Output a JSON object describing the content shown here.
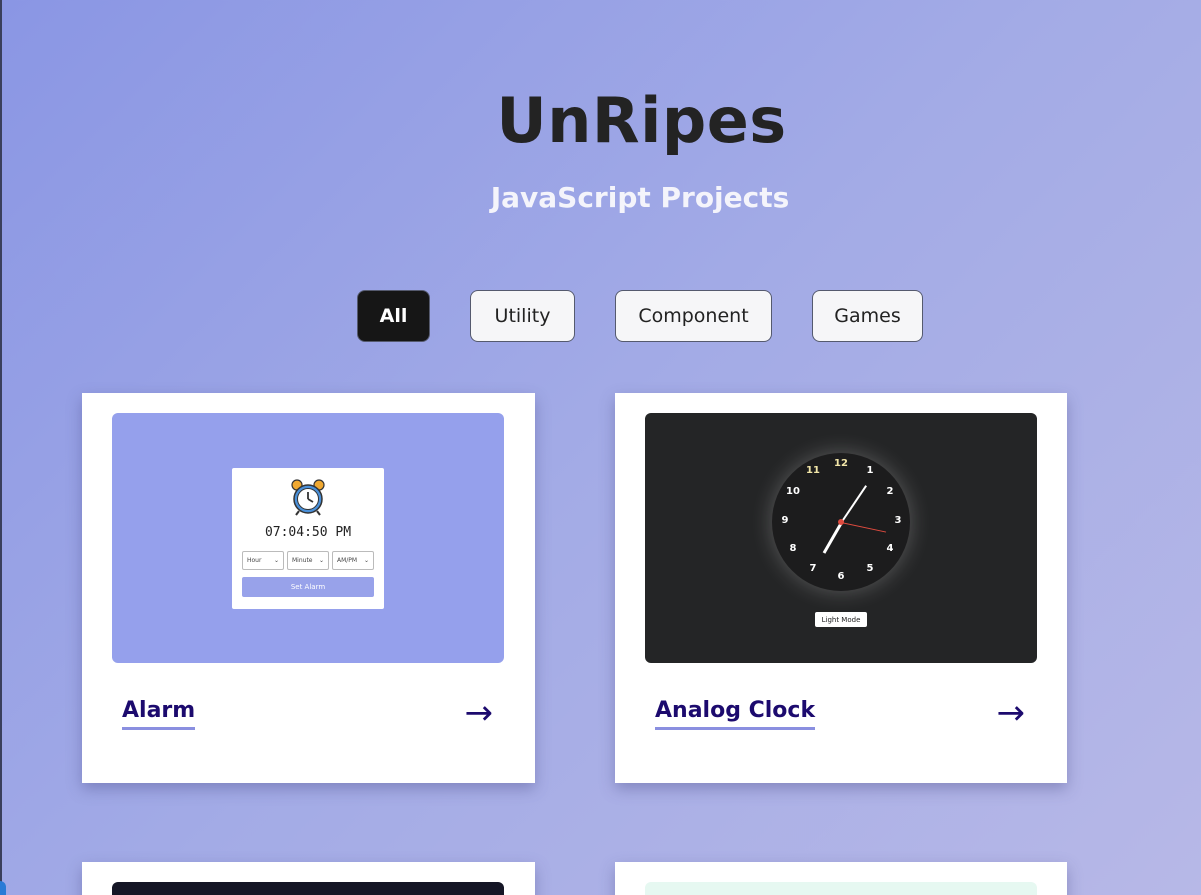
{
  "header": {
    "title": "UnRipes",
    "subtitle": "JavaScript Projects"
  },
  "filters": [
    {
      "label": "All",
      "active": true
    },
    {
      "label": "Utility",
      "active": false
    },
    {
      "label": "Component",
      "active": false
    },
    {
      "label": "Games",
      "active": false
    }
  ],
  "cards": [
    {
      "title": "Alarm",
      "arrow": "→",
      "preview": {
        "icon": "alarm-clock-icon",
        "time": "07:04:50 PM",
        "selects": [
          "Hour",
          "Minute",
          "AM/PM"
        ],
        "button": "Set Alarm"
      }
    },
    {
      "title": "Analog Clock",
      "arrow": "→",
      "preview": {
        "numbers": [
          "12",
          "1",
          "2",
          "3",
          "4",
          "5",
          "6",
          "7",
          "8",
          "9",
          "10",
          "11"
        ],
        "button": "Light Mode"
      }
    }
  ],
  "colors": {
    "accent": "#1c0a6e",
    "underline": "#8a8fe0",
    "active_filter": "#161616"
  }
}
